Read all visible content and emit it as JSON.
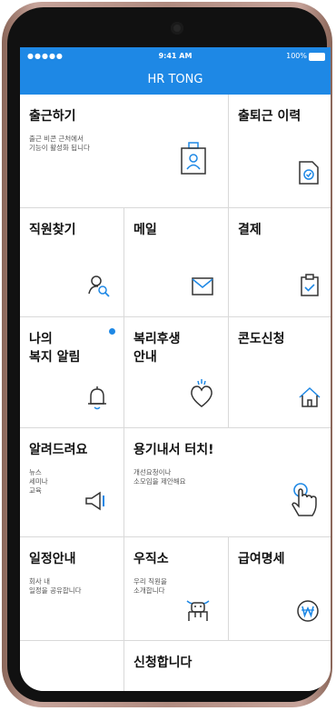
{
  "status_bar": {
    "signal": "●●●●● ",
    "time": "9:41 AM",
    "battery": "100%"
  },
  "app": {
    "title": "HR TONG"
  },
  "tiles": {
    "checkin": {
      "title": "출근하기",
      "desc": "출근 비콘 근처에서\n기능이 활성화 됩니다",
      "icon": "id-badge-icon"
    },
    "attendance": {
      "title": "출퇴근 이력",
      "icon": "document-check-icon"
    },
    "find_staff": {
      "title": "직원찾기",
      "icon": "user-search-icon"
    },
    "mail": {
      "title": "메일",
      "icon": "envelope-icon"
    },
    "approval": {
      "title": "결제",
      "icon": "clipboard-check-icon"
    },
    "welfare_alert": {
      "title": "나의\n복지 알림",
      "icon": "bell-icon",
      "has_notification": true
    },
    "welfare_info": {
      "title": "복리후생\n안내",
      "icon": "heart-icon"
    },
    "condo": {
      "title": "콘도신청",
      "icon": "house-icon"
    },
    "notice": {
      "title": "알려드려요",
      "desc": "뉴스\n세미나\n교육",
      "icon": "megaphone-icon"
    },
    "courage": {
      "title": "용기내서 터치!",
      "desc": "개선요청이나\n소모임을 제안해요",
      "icon": "hand-touch-icon"
    },
    "schedule": {
      "title": "일정안내",
      "desc": "회사 내\n일정을 공유합니다"
    },
    "mailbox": {
      "title": "우직소",
      "desc": "우리 직원을\n소개합니다",
      "icon": "cow-icon"
    },
    "payslip": {
      "title": "급여명세",
      "icon": "won-coin-icon"
    },
    "apply": {
      "title": "신청합니다"
    }
  },
  "colors": {
    "primary": "#1e88e5",
    "border": "#d9d9d9"
  }
}
